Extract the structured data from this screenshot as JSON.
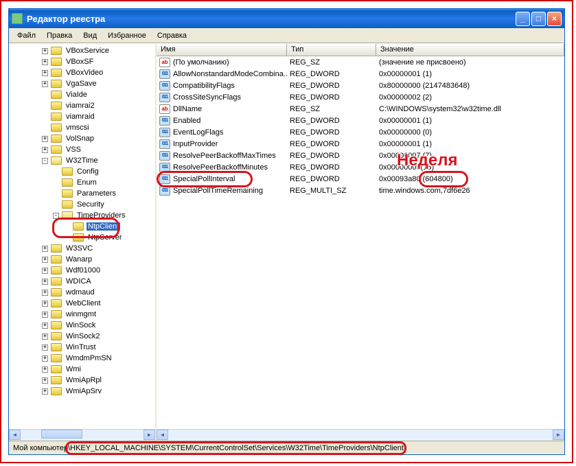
{
  "window": {
    "title": "Редактор реестра"
  },
  "menu": {
    "file": "Файл",
    "edit": "Правка",
    "view": "Вид",
    "favorites": "Избранное",
    "help": "Справка"
  },
  "columns": {
    "name": "Имя",
    "type": "Тип",
    "value": "Значение"
  },
  "tree": [
    {
      "d": 3,
      "e": "+",
      "l": "VBoxService"
    },
    {
      "d": 3,
      "e": "+",
      "l": "VBoxSF"
    },
    {
      "d": 3,
      "e": "+",
      "l": "VBoxVideo"
    },
    {
      "d": 3,
      "e": "+",
      "l": "VgaSave"
    },
    {
      "d": 3,
      "e": "",
      "l": "ViaIde"
    },
    {
      "d": 3,
      "e": "",
      "l": "viamrai2"
    },
    {
      "d": 3,
      "e": "",
      "l": "viamraid"
    },
    {
      "d": 3,
      "e": "",
      "l": "vmscsi"
    },
    {
      "d": 3,
      "e": "+",
      "l": "VolSnap"
    },
    {
      "d": 3,
      "e": "+",
      "l": "VSS"
    },
    {
      "d": 3,
      "e": "-",
      "l": "W32Time",
      "open": true
    },
    {
      "d": 4,
      "e": "",
      "l": "Config"
    },
    {
      "d": 4,
      "e": "",
      "l": "Enum"
    },
    {
      "d": 4,
      "e": "",
      "l": "Parameters"
    },
    {
      "d": 4,
      "e": "",
      "l": "Security"
    },
    {
      "d": 4,
      "e": "-",
      "l": "TimeProviders",
      "open": true
    },
    {
      "d": 5,
      "e": "",
      "l": "NtpClient",
      "sel": true
    },
    {
      "d": 5,
      "e": "",
      "l": "NtpServer"
    },
    {
      "d": 3,
      "e": "+",
      "l": "W3SVC"
    },
    {
      "d": 3,
      "e": "+",
      "l": "Wanarp"
    },
    {
      "d": 3,
      "e": "+",
      "l": "Wdf01000"
    },
    {
      "d": 3,
      "e": "+",
      "l": "WDICA"
    },
    {
      "d": 3,
      "e": "+",
      "l": "wdmaud"
    },
    {
      "d": 3,
      "e": "+",
      "l": "WebClient"
    },
    {
      "d": 3,
      "e": "+",
      "l": "winmgmt"
    },
    {
      "d": 3,
      "e": "+",
      "l": "WinSock"
    },
    {
      "d": 3,
      "e": "+",
      "l": "WinSock2"
    },
    {
      "d": 3,
      "e": "+",
      "l": "WinTrust"
    },
    {
      "d": 3,
      "e": "+",
      "l": "WmdmPmSN"
    },
    {
      "d": 3,
      "e": "+",
      "l": "Wmi"
    },
    {
      "d": 3,
      "e": "+",
      "l": "WmiApRpl"
    },
    {
      "d": 3,
      "e": "+",
      "l": "WmiApSrv"
    }
  ],
  "values": [
    {
      "i": "sz",
      "n": "(По умолчанию)",
      "t": "REG_SZ",
      "v": "(значение не присвоено)"
    },
    {
      "i": "dw",
      "n": "AllowNonstandardModeCombina...",
      "t": "REG_DWORD",
      "v": "0x00000001 (1)"
    },
    {
      "i": "dw",
      "n": "CompatibilityFlags",
      "t": "REG_DWORD",
      "v": "0x80000000 (2147483648)"
    },
    {
      "i": "dw",
      "n": "CrossSiteSyncFlags",
      "t": "REG_DWORD",
      "v": "0x00000002 (2)"
    },
    {
      "i": "sz",
      "n": "DllName",
      "t": "REG_SZ",
      "v": "C:\\WINDOWS\\system32\\w32time.dll"
    },
    {
      "i": "dw",
      "n": "Enabled",
      "t": "REG_DWORD",
      "v": "0x00000001 (1)"
    },
    {
      "i": "dw",
      "n": "EventLogFlags",
      "t": "REG_DWORD",
      "v": "0x00000000 (0)"
    },
    {
      "i": "dw",
      "n": "InputProvider",
      "t": "REG_DWORD",
      "v": "0x00000001 (1)"
    },
    {
      "i": "dw",
      "n": "ResolvePeerBackoffMaxTimes",
      "t": "REG_DWORD",
      "v": "0x00000007 (7)"
    },
    {
      "i": "dw",
      "n": "ResolvePeerBackoffMinutes",
      "t": "REG_DWORD",
      "v": "0x0000000f (15)"
    },
    {
      "i": "dw",
      "n": "SpecialPollInterval",
      "t": "REG_DWORD",
      "v": "0x00093a80 (604800)"
    },
    {
      "i": "dw",
      "n": "SpecialPollTimeRemaining",
      "t": "REG_MULTI_SZ",
      "v": "time.windows.com,7df6e26"
    }
  ],
  "status": {
    "prefix": "Мой компьютер",
    "path": "\\HKEY_LOCAL_MACHINE\\SYSTEM\\CurrentControlSet\\Services\\W32Time\\TimeProviders\\NtpClient"
  },
  "annotation": {
    "week": "Неделя"
  }
}
